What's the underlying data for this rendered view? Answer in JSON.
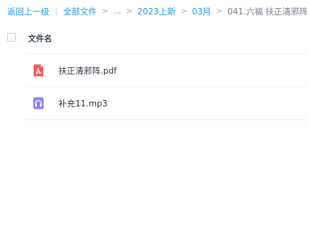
{
  "breadcrumb": {
    "back": "返回上一级",
    "all_files": "全部文件",
    "ellipsis": "...",
    "folder1": "2023上新",
    "folder2": "03月",
    "current": "041.六福 扶正清邪阵",
    "separator_bar": "|",
    "separator": ">"
  },
  "list": {
    "column_name": "文件名",
    "files": [
      {
        "name": "扶正清邪阵.pdf",
        "icon": "pdf-icon",
        "color": "#f25b5b"
      },
      {
        "name": "补充11.mp3",
        "icon": "audio-icon",
        "color": "#8c86f2"
      }
    ]
  }
}
